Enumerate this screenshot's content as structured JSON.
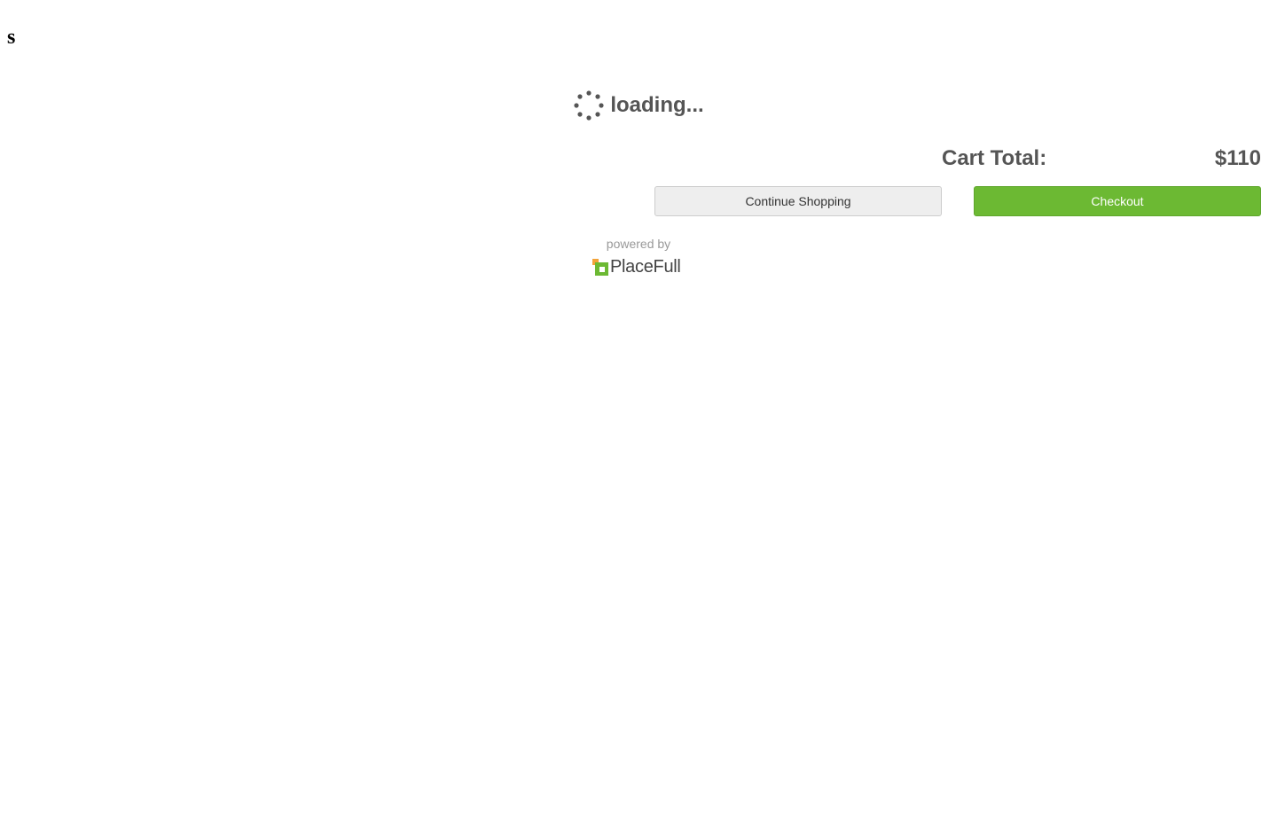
{
  "page": {
    "corner_text": "s"
  },
  "loader": {
    "text": "loading...",
    "icon": "spinner-icon"
  },
  "cart": {
    "total_label": "Cart Total:",
    "total_value": "$110"
  },
  "actions": {
    "continue_label": "Continue Shopping",
    "checkout_label": "Checkout"
  },
  "footer": {
    "powered_by": "powered by",
    "brand_name": "PlaceFull",
    "brand_icon": "placefull-logo-icon"
  },
  "colors": {
    "checkout_green": "#6cb933",
    "text_gray": "#555555",
    "logo_orange": "#f2a33a",
    "logo_green": "#6cb933"
  }
}
